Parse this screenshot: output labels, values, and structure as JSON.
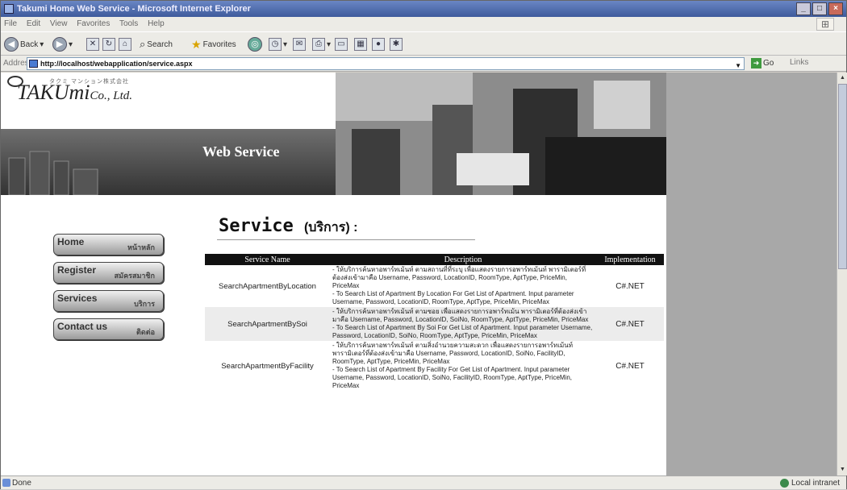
{
  "window": {
    "title": "Takumi Home Web Service - Microsoft Internet Explorer",
    "buttons": [
      "_",
      "□",
      "×"
    ]
  },
  "menu": [
    "File",
    "Edit",
    "View",
    "Favorites",
    "Tools",
    "Help"
  ],
  "toolbar": {
    "back": "Back",
    "search": "Search",
    "favorites": "Favorites"
  },
  "address": {
    "label": "Address",
    "url": "http://localhost/webapplication/service.aspx",
    "go": "Go",
    "links": "Links"
  },
  "status": {
    "left": "Done",
    "zone": "Local intranet"
  },
  "site": {
    "logo": "TAKUmi",
    "logo_suffix": "Co., Ltd.",
    "logo_kana": "タクミ マンション株式会社",
    "banner_title": "Web Service",
    "nav": [
      {
        "en": "Home",
        "th": "หน้าหลัก"
      },
      {
        "en": "Register",
        "th": "สมัครสมาชิก"
      },
      {
        "en": "Services",
        "th": "บริการ"
      },
      {
        "en": "Contact us",
        "th": "ติดต่อ"
      }
    ],
    "heading": "Service",
    "heading_thai": "(บริการ) :",
    "table": {
      "headers": [
        "Service Name",
        "Description",
        "Implementation"
      ],
      "rows": [
        {
          "name": "SearchApartmentByLocation",
          "desc_th": "- ให้บริการค้นหาอพาร์ทเม้นท์ ตามสถานที่ที่ระบุ เพื่อแสดงรายการอพาร์ทเม้นท์ พารามิเตอร์ที่ต้องส่งเข้ามาคือ Username, Password, LocationID, RoomType, AptType, PriceMin, PriceMax",
          "desc_en": "- To Search List of Apartment By Location For Get List of Apartment. Input parameter Username, Password, LocationID, RoomType, AptType, PriceMin, PriceMax",
          "impl": "C#.NET"
        },
        {
          "name": "SearchApartmentBySoi",
          "desc_th": "- ให้บริการค้นหาอพาร์ทเม้นท์ ตามซอย เพื่อแสดงรายการอพาร์ทเม้น พารามิเตอร์ที่ต้องส่งเข้ามาคือ Username, Password, LocationID, SoiNo, RoomType, AptType, PriceMin, PriceMax",
          "desc_en": "- To Search List of Apartment By Soi For Get List of Apartment. Input parameter Username, Password, LocationID, SoiNo, RoomType, AptType, PriceMin, PriceMax",
          "impl": "C#.NET"
        },
        {
          "name": "SearchApartmentByFacility",
          "desc_th": "- ให้บริการค้นหาอพาร์ทเม้นท์ ตามสิ่งอำนวยความสะดวก เพื่อแสดงรายการอพาร์ทเม้นท์ พารามิเตอร์ที่ต้องส่งเข้ามาคือ Username, Password, LocationID, SoiNo, FacilityID, RoomType, AptType, PriceMin, PriceMax",
          "desc_en": "- To Search List of Apartment By Facility For Get List of Apartment. Input parameter Username, Password, LocationID, SoiNo, FacilityID, RoomType, AptType, PriceMin, PriceMax",
          "impl": "C#.NET"
        }
      ]
    }
  }
}
